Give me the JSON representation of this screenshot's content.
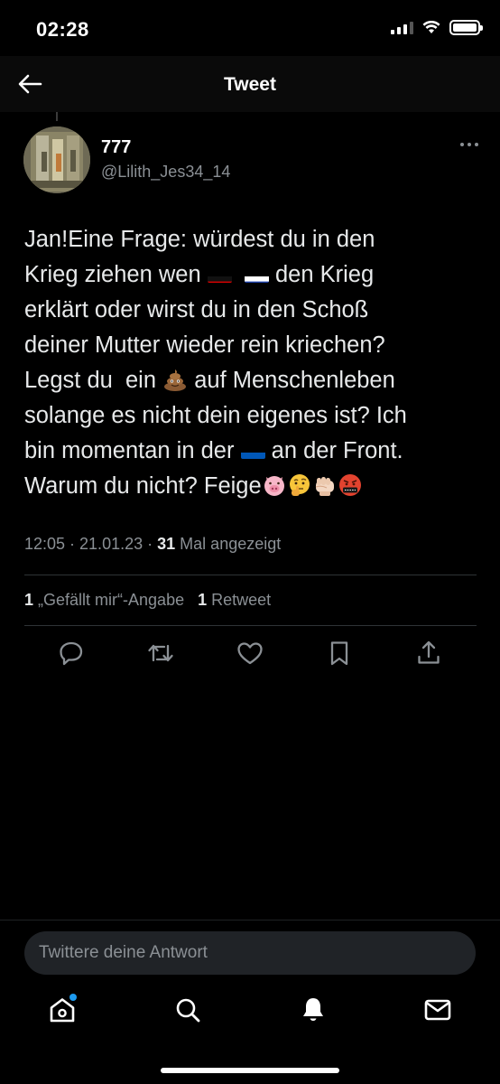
{
  "status_bar": {
    "time": "02:28"
  },
  "nav": {
    "title": "Tweet"
  },
  "tweet": {
    "display_name": "777",
    "handle": "@Lilith_Jes34_14",
    "text_lines": [
      [
        "Jan!Eine Frage: würdest du in den"
      ],
      [
        "Krieg ziehen wen",
        "den Krieg"
      ],
      [
        "erklärt oder wirst du in den Schoß"
      ],
      [
        "deiner Mutter wieder rein kriechen?"
      ],
      [
        "Legst du  ein",
        "auf Menschenleben"
      ],
      [
        "solange es nicht dein eigenes ist? Ich"
      ],
      [
        "bin momentan in der",
        "an der Front."
      ],
      [
        "Warum du nicht? Feige"
      ]
    ],
    "inline_icons": [
      "flag-germany",
      "flag-russia",
      "poop-emoji",
      "flag-ukraine",
      "pig-face-emoji",
      "thinking-face-emoji",
      "fist-emoji",
      "cursing-face-emoji"
    ],
    "timestamp": "12:05 · 21.01.23 ·",
    "views_count": "31",
    "views_label": "Mal angezeigt",
    "likes_count": "1",
    "likes_label": "„Gefällt mir“-Angabe",
    "retweets_count": "1",
    "retweets_label": "Retweet"
  },
  "reply": {
    "placeholder": "Twittere deine Antwort"
  },
  "tabs": [
    "home-icon",
    "search-icon",
    "notifications-icon",
    "messages-icon"
  ],
  "colors": {
    "accent": "#1d9bf0",
    "background": "#000000",
    "secondary_text": "#8b9095"
  }
}
